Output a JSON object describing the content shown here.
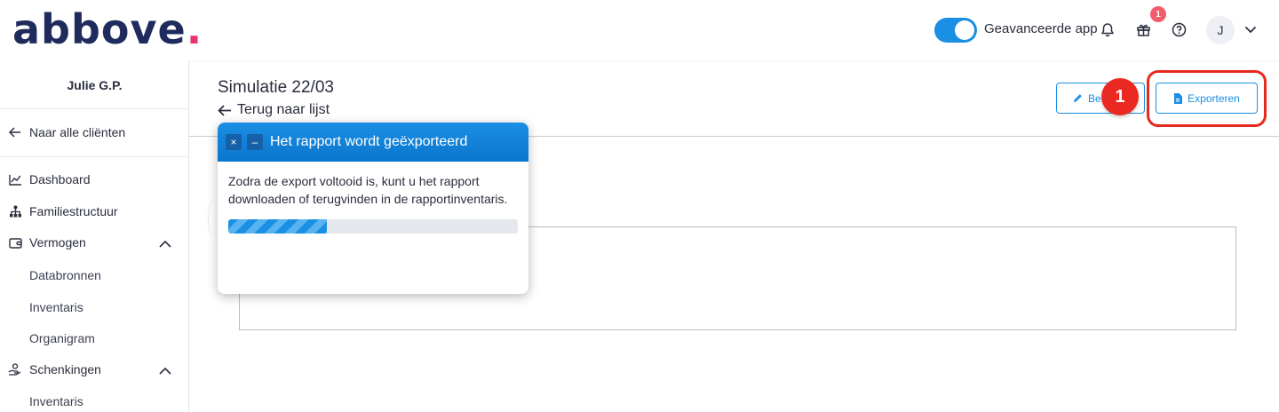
{
  "header": {
    "logo_text": "abbove",
    "logo_dot": ".",
    "advanced_toggle_label": "Geavanceerde app",
    "advanced_toggle_on": true,
    "gift_badge_count": "1",
    "avatar_initial": "J",
    "icons": [
      "bell-icon",
      "gift-icon",
      "help-icon",
      "chevron-down-icon"
    ]
  },
  "sidebar": {
    "client_name": "Julie G.P.",
    "back_to_clients": "Naar alle cliënten",
    "items": [
      {
        "label": "Dashboard",
        "icon": "chart-line-icon"
      },
      {
        "label": "Familiestructuur",
        "icon": "org-chart-icon"
      },
      {
        "label": "Vermogen",
        "icon": "wallet-icon",
        "expanded": true
      },
      {
        "label": "Schenkingen",
        "icon": "hand-coin-icon",
        "expanded": true
      }
    ],
    "vermogen_sub": [
      "Databronnen",
      "Inventaris",
      "Organigram"
    ],
    "schenkingen_sub": [
      "Inventaris"
    ]
  },
  "main": {
    "title": "Simulatie 22/03",
    "back_link": "Terug naar lijst",
    "edit_button_label": "Be",
    "export_button_label": "Exporteren",
    "step_marker": "1"
  },
  "dialog": {
    "title": "Het rapport wordt geëxporteerd",
    "close_symbol": "×",
    "minimize_symbol": "–",
    "message": "Zodra de export voltooid is, kunt u het rapport downloaden of terugvinden in de rapportinventaris.",
    "progress_fraction": 0.34
  },
  "colors": {
    "brand_navy": "#1f2b5c",
    "brand_pink": "#e8336b",
    "accent_blue": "#1a8fe3",
    "highlight_red": "#e8271d"
  }
}
